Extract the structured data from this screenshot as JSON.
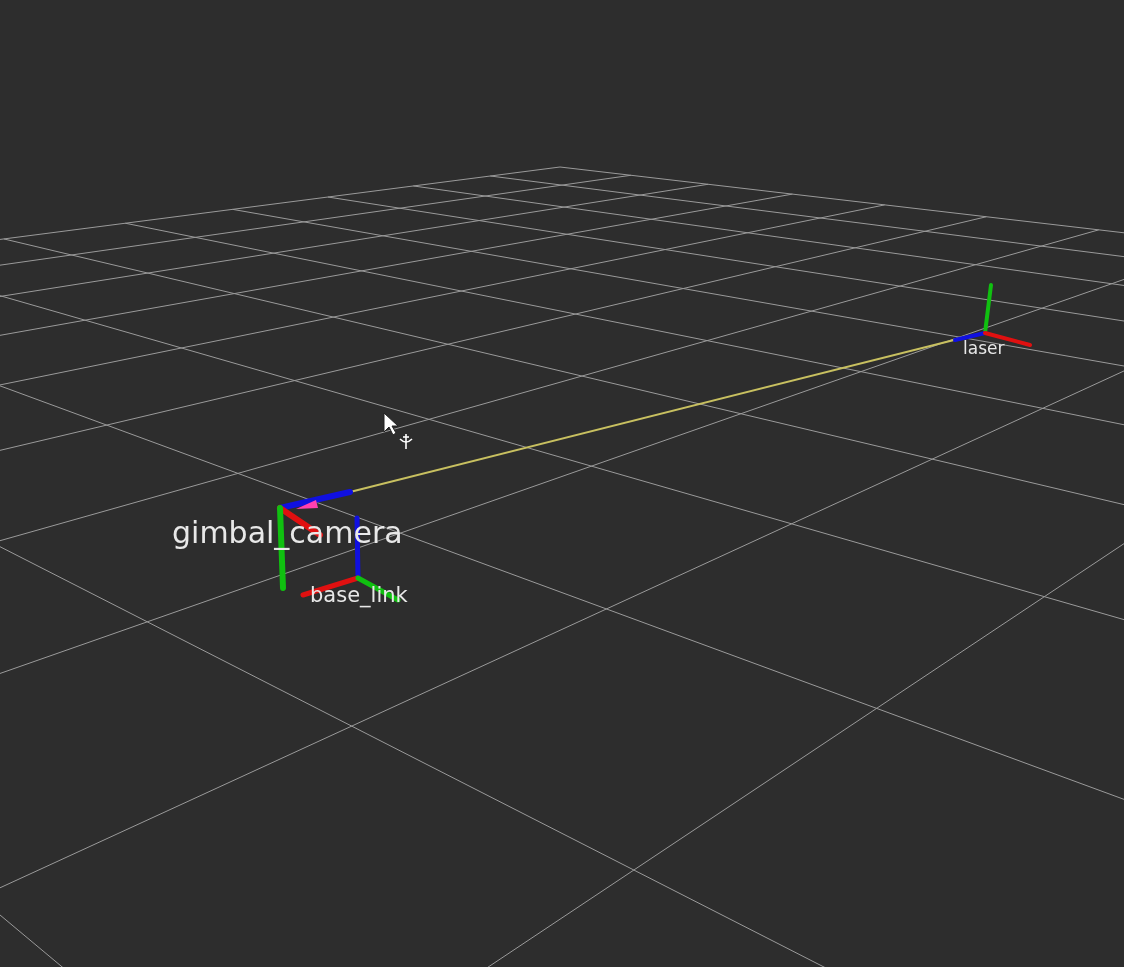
{
  "viewport": {
    "frames": [
      {
        "label": "gimbal_camera"
      },
      {
        "label": "base_link"
      },
      {
        "label": "laser"
      }
    ]
  }
}
